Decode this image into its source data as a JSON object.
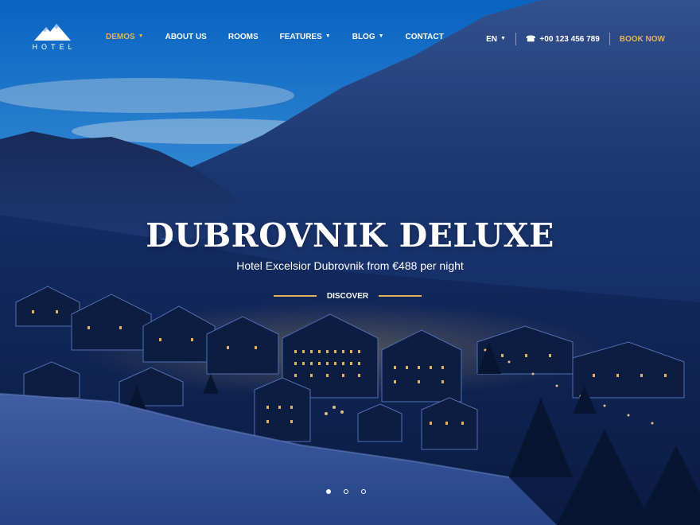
{
  "brand": {
    "logo_text": "HOTEL",
    "logo_icon": "mountain-icon"
  },
  "nav": {
    "items": [
      {
        "label": "DEMOS",
        "dropdown": true,
        "active": true
      },
      {
        "label": "ABOUT US",
        "dropdown": false
      },
      {
        "label": "ROOMS",
        "dropdown": false
      },
      {
        "label": "FEATURES",
        "dropdown": true
      },
      {
        "label": "BLOG",
        "dropdown": true
      },
      {
        "label": "CONTACT",
        "dropdown": false
      }
    ]
  },
  "header_right": {
    "language": "EN",
    "phone": "+00 123 456 789",
    "book_label": "BOOK NOW"
  },
  "hero": {
    "title": "DUBROVNIK DELUXE",
    "subtitle": "Hotel Excelsior Dubrovnik from €488 per night",
    "cta_label": "DISCOVER"
  },
  "slider": {
    "count": 3,
    "active_index": 0
  },
  "colors": {
    "accent": "#e2b25a",
    "text": "#ffffff"
  }
}
